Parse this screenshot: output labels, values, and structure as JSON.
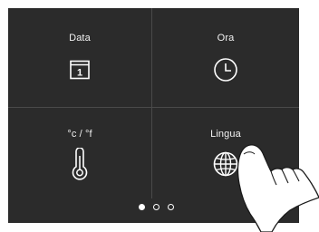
{
  "tiles": [
    {
      "label": "Data",
      "icon": "calendar-icon",
      "day": "1"
    },
    {
      "label": "Ora",
      "icon": "clock-icon"
    },
    {
      "label": "°c / °f",
      "icon": "thermometer-icon"
    },
    {
      "label": "Lingua",
      "icon": "globe-icon"
    }
  ],
  "pager": {
    "pages": 3,
    "active": 1
  },
  "colors": {
    "screen": "#2b2b2b",
    "divider": "#4a4a4a",
    "foreground": "#ffffff"
  },
  "overlay_icon": "pointing-hand-icon"
}
